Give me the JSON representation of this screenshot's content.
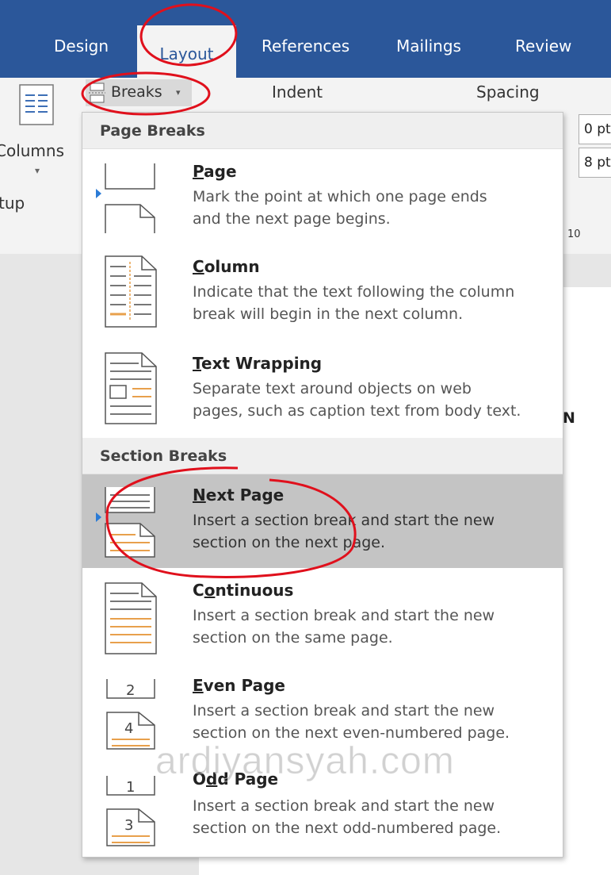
{
  "tabs": [
    "Design",
    "Layout",
    "References",
    "Mailings",
    "Review"
  ],
  "ribbon": {
    "columns_label": "Columns",
    "setup_label": "tup",
    "breaks_label": "Breaks",
    "indent_label": "Indent",
    "spacing_label": "Spacing",
    "spacing_before": "0 pt",
    "spacing_after": "8 pt",
    "ruler_mark": "10"
  },
  "menu": {
    "page_breaks_header": "Page Breaks",
    "section_breaks_header": "Section Breaks",
    "items": [
      {
        "title": "Page",
        "accel": "P",
        "desc_lines": [
          "Mark the point at which one page ends",
          "and the next page begins."
        ],
        "icon": "page-break-icon"
      },
      {
        "title": "Column",
        "accel": "C",
        "desc_lines": [
          "Indicate that the text following the column",
          "break will begin in the next column."
        ],
        "icon": "column-break-icon"
      },
      {
        "title": "Text Wrapping",
        "accel": "T",
        "desc_lines": [
          "Separate text around objects on web",
          "pages, such as caption text from body text."
        ],
        "icon": "text-wrapping-icon"
      },
      {
        "title": "Next Page",
        "accel": "N",
        "desc_lines": [
          "Insert a section break and start the new",
          "section on the next page."
        ],
        "icon": "next-page-icon"
      },
      {
        "title": "Continuous",
        "accel": "o",
        "desc_lines": [
          "Insert a section break and start the new",
          "section on the same page."
        ],
        "icon": "continuous-icon"
      },
      {
        "title": "Even Page",
        "accel": "E",
        "desc_lines": [
          "Insert a section break and start the new",
          "section on the next even-numbered page."
        ],
        "icon": "even-page-icon"
      },
      {
        "title": "Odd Page",
        "accel": "d",
        "desc_lines": [
          "Insert a section break and start the new",
          "section on the next odd-numbered page."
        ],
        "icon": "odd-page-icon"
      }
    ]
  },
  "doc_fragment": "N",
  "watermark": "ardiyansyah.com",
  "colors": {
    "ribbon_blue": "#2b579a",
    "icon_orange": "#e8a04c",
    "annotation_red": "#e0101c",
    "selected_bg": "#c4c4c4"
  }
}
